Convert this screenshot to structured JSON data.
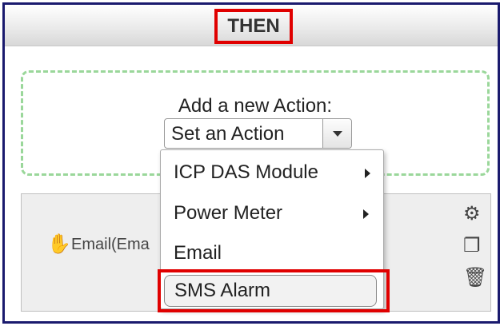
{
  "header": {
    "title": "THEN"
  },
  "add_action": {
    "label": "Add a new Action:",
    "select_value": "Set an Action"
  },
  "action_row": {
    "text": "Email(Ema",
    "icons": [
      "hand-icon",
      "gear-icon",
      "copy-icon",
      "trash-icon"
    ]
  },
  "menu": {
    "items": [
      {
        "label": "ICP DAS Module",
        "has_submenu": true
      },
      {
        "label": "Power Meter",
        "has_submenu": true
      },
      {
        "label": "Email",
        "has_submenu": false
      },
      {
        "label": "SMS Alarm",
        "has_submenu": false,
        "highlighted": true
      }
    ]
  },
  "colors": {
    "highlight_border": "#e00000",
    "panel_border": "#1a1a6e",
    "drop_zone_border": "#9ad79a"
  }
}
